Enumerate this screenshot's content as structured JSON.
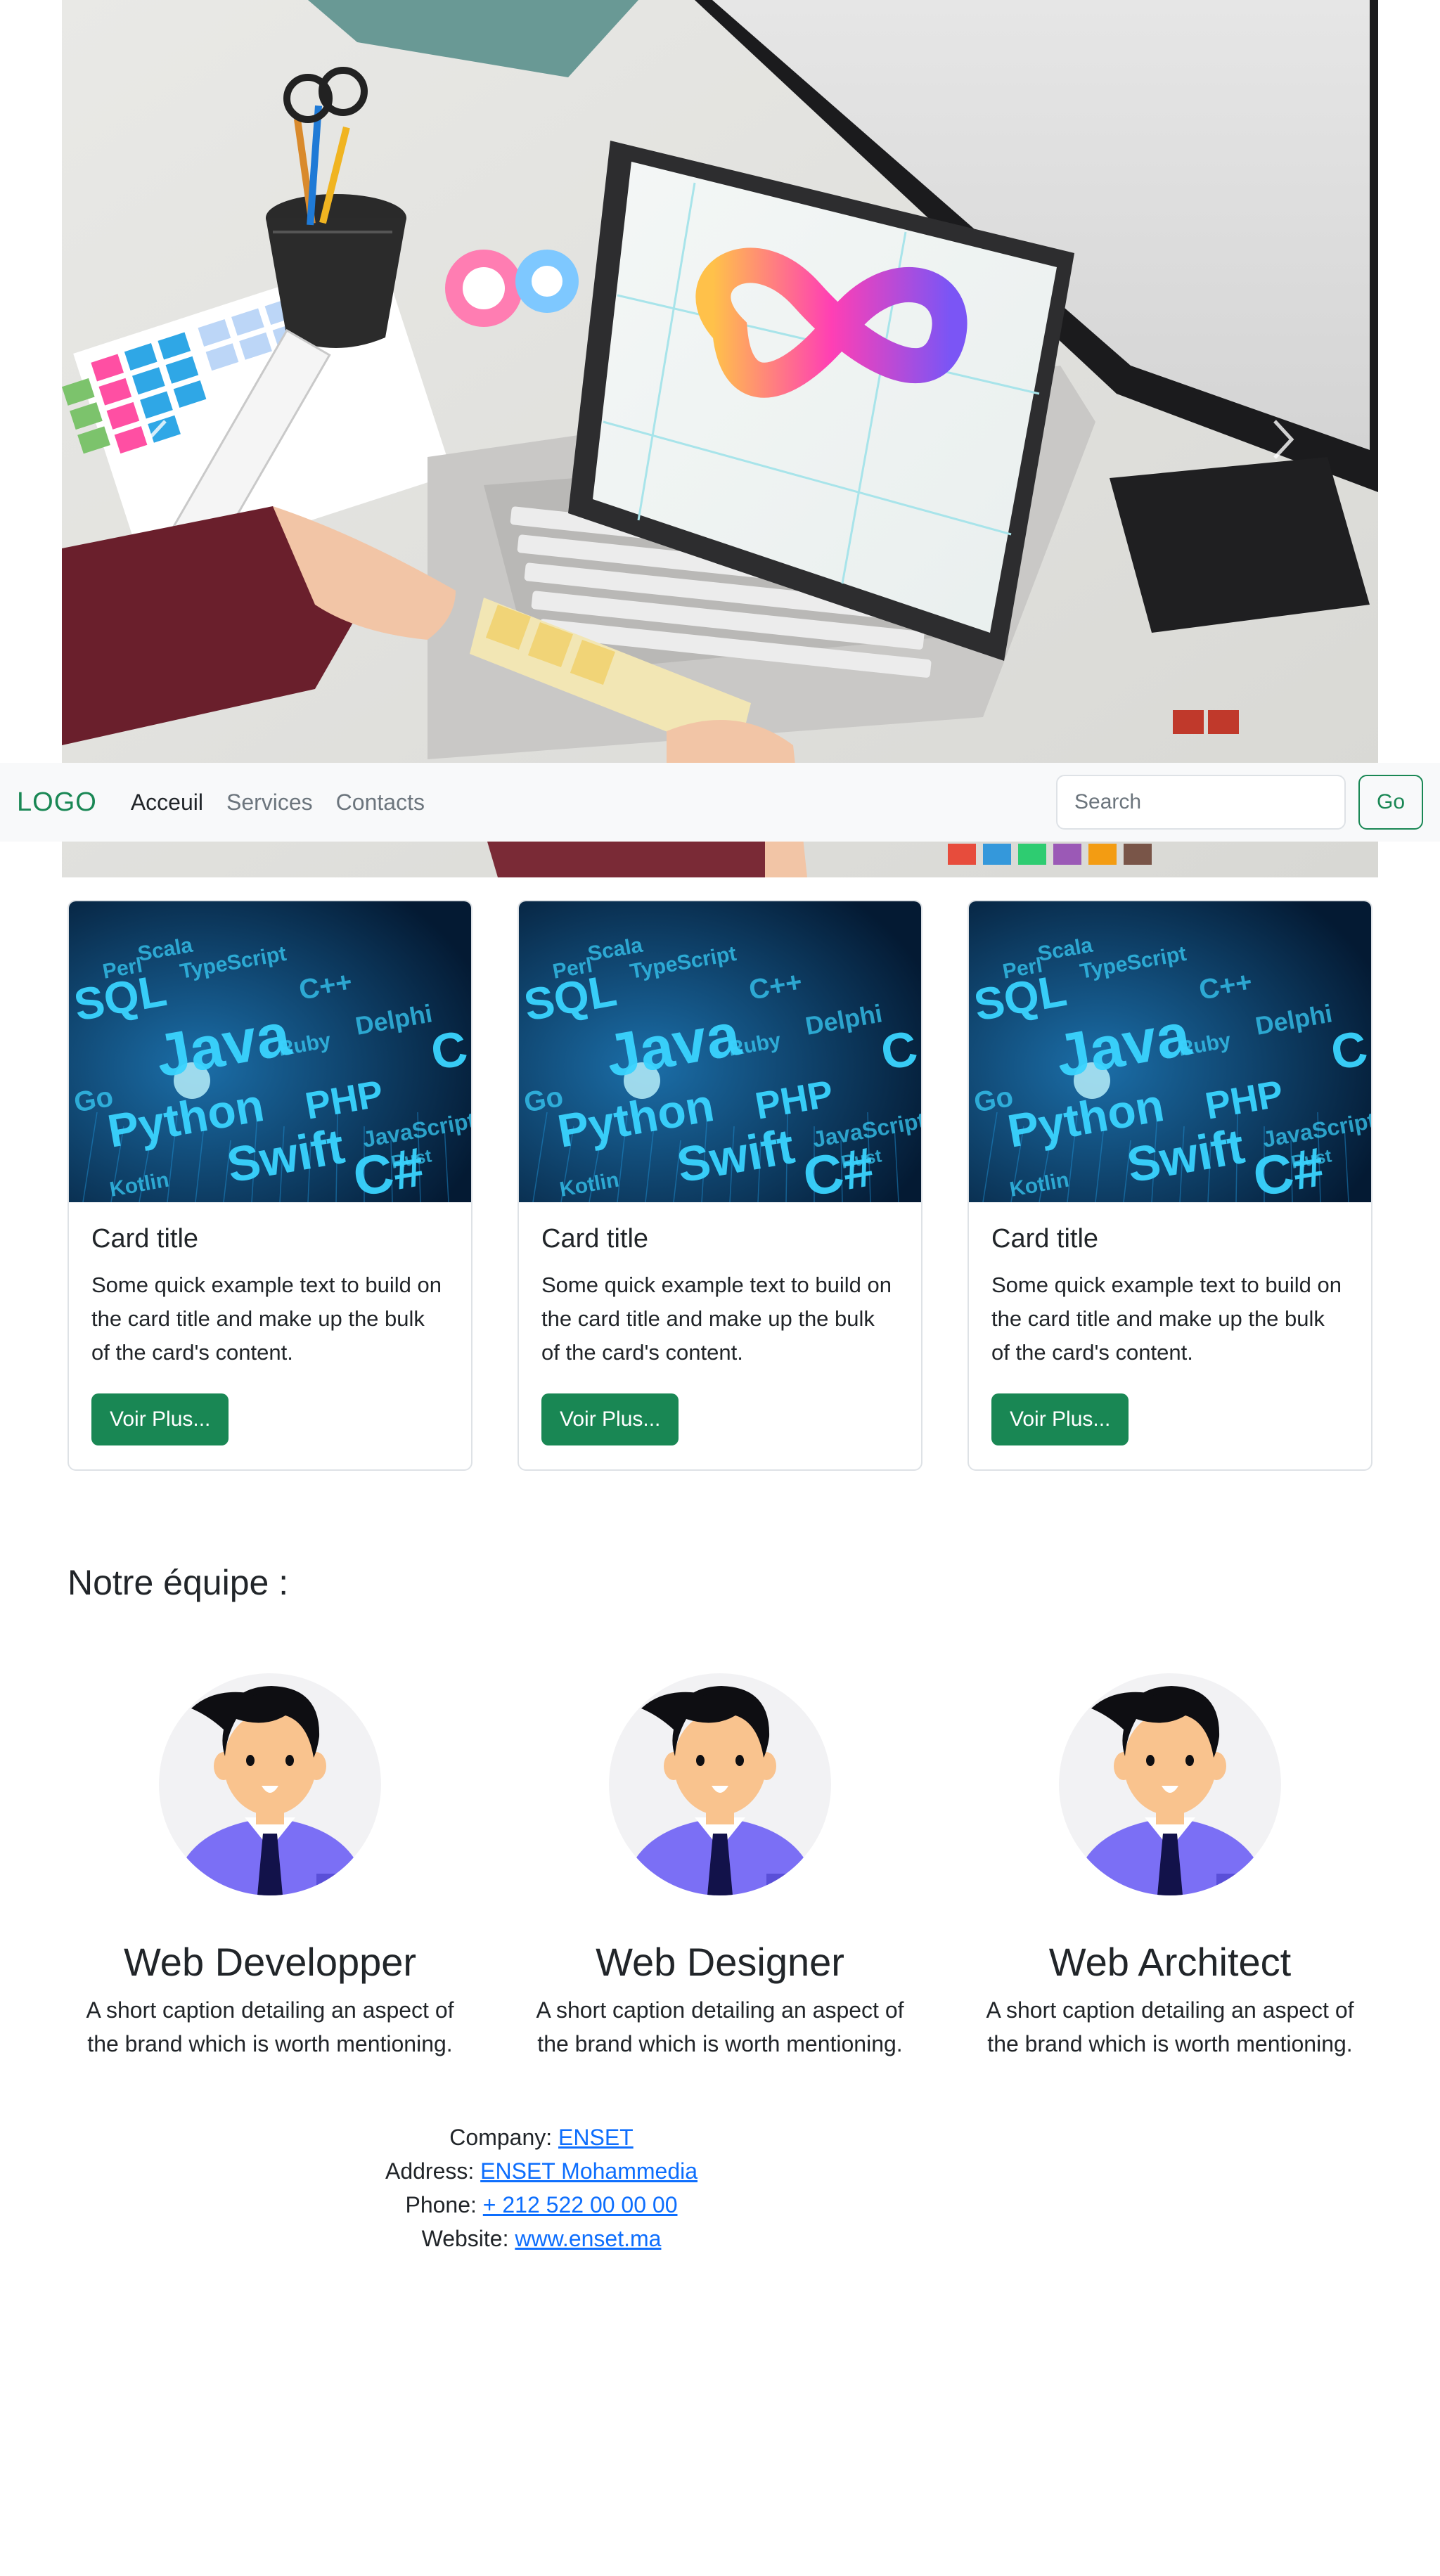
{
  "carousel": {
    "prev_icon": "chevron-left-icon",
    "next_icon": "chevron-right-icon"
  },
  "navbar": {
    "brand": "LOGO",
    "links": [
      {
        "label": "Acceuil",
        "active": true
      },
      {
        "label": "Services",
        "active": false
      },
      {
        "label": "Contacts",
        "active": false
      }
    ],
    "search": {
      "placeholder": "Search",
      "value": ""
    },
    "go_label": "Go"
  },
  "cards": [
    {
      "title": "Card title",
      "text": "Some quick example text to build on the card title and make up the bulk of the card's content.",
      "button": "Voir Plus..."
    },
    {
      "title": "Card title",
      "text": "Some quick example text to build on the card title and make up the bulk of the card's content.",
      "button": "Voir Plus..."
    },
    {
      "title": "Card title",
      "text": "Some quick example text to build on the card title and make up the bulk of the card's content.",
      "button": "Voir Plus..."
    }
  ],
  "team": {
    "heading": "Notre équipe :",
    "members": [
      {
        "title": "Web Developper",
        "caption": "A short caption detailing an aspect of the brand which is worth mentioning."
      },
      {
        "title": "Web Designer",
        "caption": "A short caption detailing an aspect of the brand which is worth mentioning."
      },
      {
        "title": "Web Architect",
        "caption": "A short caption detailing an aspect of the brand which is worth mentioning."
      }
    ]
  },
  "card_image_words": [
    "SQL",
    "Java",
    "Python",
    "Swift",
    "C#",
    "PHP",
    "C++",
    "Ruby",
    "Perl",
    "Scala",
    "TypeScript",
    "Kotlin",
    "JavaScript",
    "Go",
    "Rust",
    "Delphi",
    "C"
  ],
  "info": {
    "company_label": "Company:",
    "company_value": "ENSET",
    "address_label": "Address:",
    "address_value": "ENSET Mohammedia",
    "phone_label": "Phone:",
    "phone_value": "+ 212 522 00 00 00",
    "website_label": "Website:",
    "website_value": "www.enset.ma"
  },
  "colors": {
    "primary_green": "#198754",
    "link_blue": "#0d6efd",
    "navbar_bg": "#f8f9fa"
  }
}
